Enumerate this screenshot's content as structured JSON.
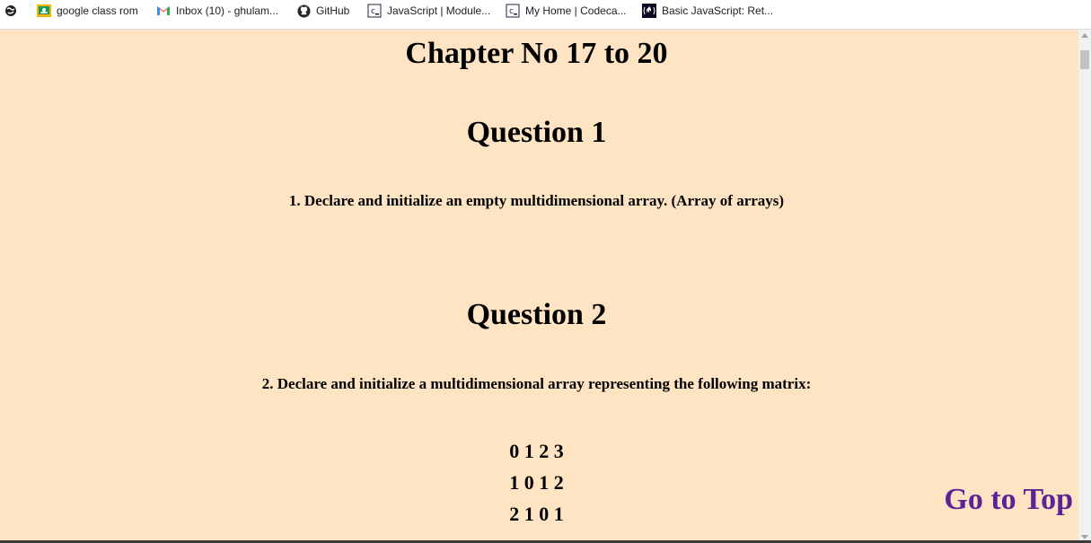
{
  "bookmarks": [
    {
      "label": "",
      "icon": "globe-icon"
    },
    {
      "label": "google class rom",
      "icon": "google-classroom-icon"
    },
    {
      "label": "Inbox (10) - ghulam...",
      "icon": "gmail-icon"
    },
    {
      "label": "GitHub",
      "icon": "github-icon"
    },
    {
      "label": "JavaScript | Module...",
      "icon": "codecademy-icon"
    },
    {
      "label": "My Home | Codeca...",
      "icon": "codecademy-icon"
    },
    {
      "label": "Basic JavaScript: Ret...",
      "icon": "freecodecamp-icon"
    }
  ],
  "page": {
    "title": "Chapter No 17 to 20",
    "background": "#ffe4c4",
    "sections": [
      {
        "heading": "Question 1",
        "text": "1. Declare and initialize an empty multidimensional array. (Array of arrays)"
      },
      {
        "heading": "Question 2",
        "text": "2. Declare and initialize a multidimensional array representing the following matrix:"
      }
    ],
    "matrix": [
      "0 1 2 3",
      "1 0 1 2",
      "2 1 0 1"
    ],
    "go_to_top": "Go to Top",
    "link_color": "#5b2496"
  }
}
